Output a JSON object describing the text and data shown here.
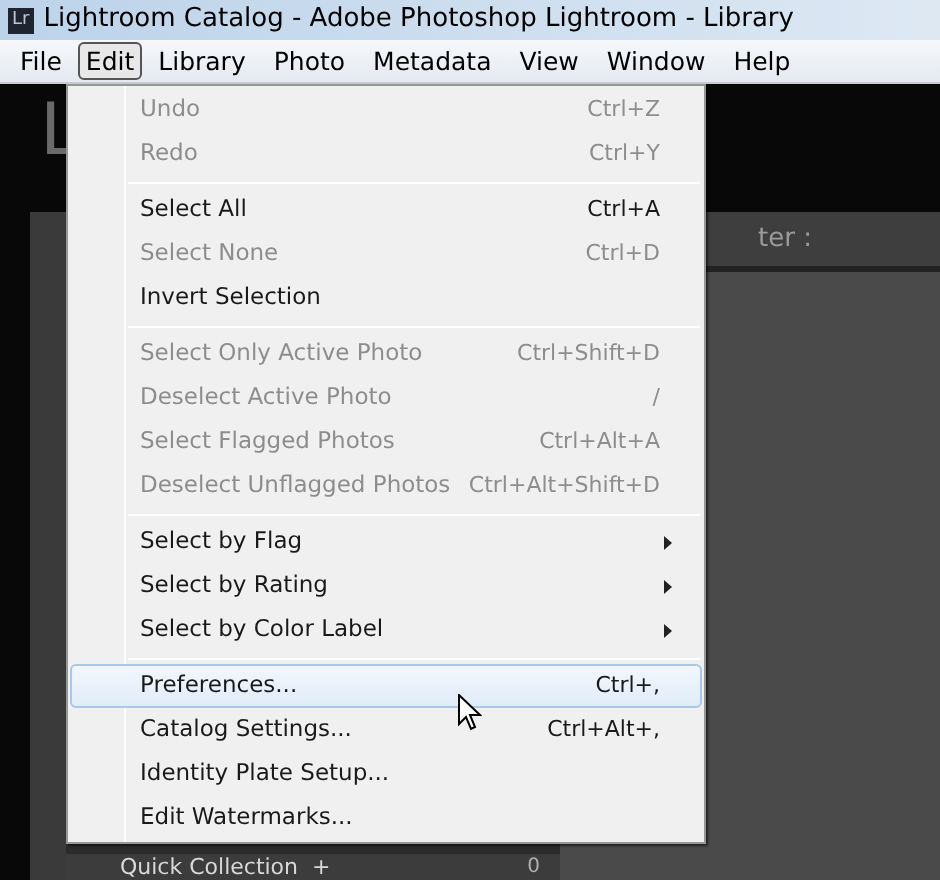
{
  "window": {
    "app_badge": "Lr",
    "title": "Lightroom Catalog - Adobe Photoshop Lightroom - Library"
  },
  "menu_bar": [
    {
      "label": "File",
      "selected": false
    },
    {
      "label": "Edit",
      "selected": true
    },
    {
      "label": "Library",
      "selected": false
    },
    {
      "label": "Photo",
      "selected": false
    },
    {
      "label": "Metadata",
      "selected": false
    },
    {
      "label": "View",
      "selected": false
    },
    {
      "label": "Window",
      "selected": false
    },
    {
      "label": "Help",
      "selected": false
    }
  ],
  "background": {
    "logo_letter": "L",
    "filter_label": "ter :",
    "collection_label": "Quick Collection  +",
    "collection_count": "0"
  },
  "edit_menu": [
    {
      "kind": "item",
      "label": "Undo",
      "shortcut": "Ctrl+Z",
      "disabled": true,
      "submenu": false,
      "selected": false
    },
    {
      "kind": "item",
      "label": "Redo",
      "shortcut": "Ctrl+Y",
      "disabled": true,
      "submenu": false,
      "selected": false
    },
    {
      "kind": "separator"
    },
    {
      "kind": "item",
      "label": "Select All",
      "shortcut": "Ctrl+A",
      "disabled": false,
      "submenu": false,
      "selected": false
    },
    {
      "kind": "item",
      "label": "Select None",
      "shortcut": "Ctrl+D",
      "disabled": true,
      "submenu": false,
      "selected": false
    },
    {
      "kind": "item",
      "label": "Invert Selection",
      "disabled": false,
      "submenu": false,
      "selected": false
    },
    {
      "kind": "separator"
    },
    {
      "kind": "item",
      "label": "Select Only Active Photo",
      "shortcut": "Ctrl+Shift+D",
      "disabled": true,
      "submenu": false,
      "selected": false
    },
    {
      "kind": "item",
      "label": "Deselect Active Photo",
      "shortcut": "/",
      "disabled": true,
      "submenu": false,
      "selected": false
    },
    {
      "kind": "item",
      "label": "Select Flagged Photos",
      "shortcut": "Ctrl+Alt+A",
      "disabled": true,
      "submenu": false,
      "selected": false
    },
    {
      "kind": "item",
      "label": "Deselect Unflagged Photos",
      "shortcut": "Ctrl+Alt+Shift+D",
      "disabled": true,
      "submenu": false,
      "selected": false
    },
    {
      "kind": "separator"
    },
    {
      "kind": "item",
      "label": "Select by Flag",
      "disabled": false,
      "submenu": true,
      "selected": false
    },
    {
      "kind": "item",
      "label": "Select by Rating",
      "disabled": false,
      "submenu": true,
      "selected": false
    },
    {
      "kind": "item",
      "label": "Select by Color Label",
      "disabled": false,
      "submenu": true,
      "selected": false
    },
    {
      "kind": "separator"
    },
    {
      "kind": "item",
      "label": "Preferences...",
      "shortcut": "Ctrl+,",
      "disabled": false,
      "submenu": false,
      "selected": true
    },
    {
      "kind": "item",
      "label": "Catalog Settings...",
      "shortcut": "Ctrl+Alt+,",
      "disabled": false,
      "submenu": false,
      "selected": false
    },
    {
      "kind": "item",
      "label": "Identity Plate Setup...",
      "disabled": false,
      "submenu": false,
      "selected": false
    },
    {
      "kind": "item",
      "label": "Edit Watermarks...",
      "disabled": false,
      "submenu": false,
      "selected": false
    }
  ]
}
